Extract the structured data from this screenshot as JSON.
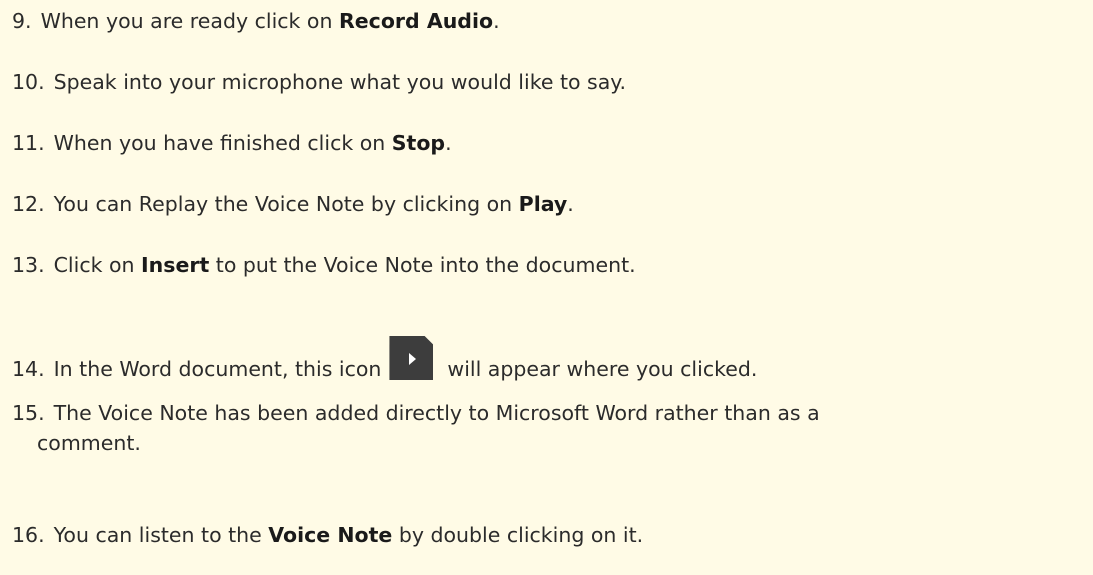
{
  "steps": [
    {
      "num": "9.",
      "pre": "When you are ready click on ",
      "bold": "Record Audio",
      "post": "."
    },
    {
      "num": "10.",
      "text": "Speak into your microphone what you would like to say."
    },
    {
      "num": "11.",
      "pre": "When you have finished click on ",
      "bold": "Stop",
      "post": "."
    },
    {
      "num": "12.",
      "pre": "You can Replay the Voice Note by clicking on ",
      "bold": "Play",
      "post": "."
    },
    {
      "num": "13.",
      "pre": "Click on ",
      "bold": "Insert",
      "post": " to put the Voice Note into the document."
    },
    {
      "num": "14.",
      "pre": "In the Word document, this icon",
      "icon": "voice-note-play-icon",
      "post": "will appear where you clicked."
    },
    {
      "num": "15.",
      "line1": "The Voice Note has been added directly to Microsoft Word rather than as a",
      "line2": "comment."
    },
    {
      "num": "16.",
      "pre": "You can listen to the ",
      "bold": "Voice Note",
      "post": " by double clicking on it."
    }
  ],
  "colors": {
    "background": "#fffbe6",
    "text": "#2b2b2b",
    "icon": "#3d3d3d"
  }
}
